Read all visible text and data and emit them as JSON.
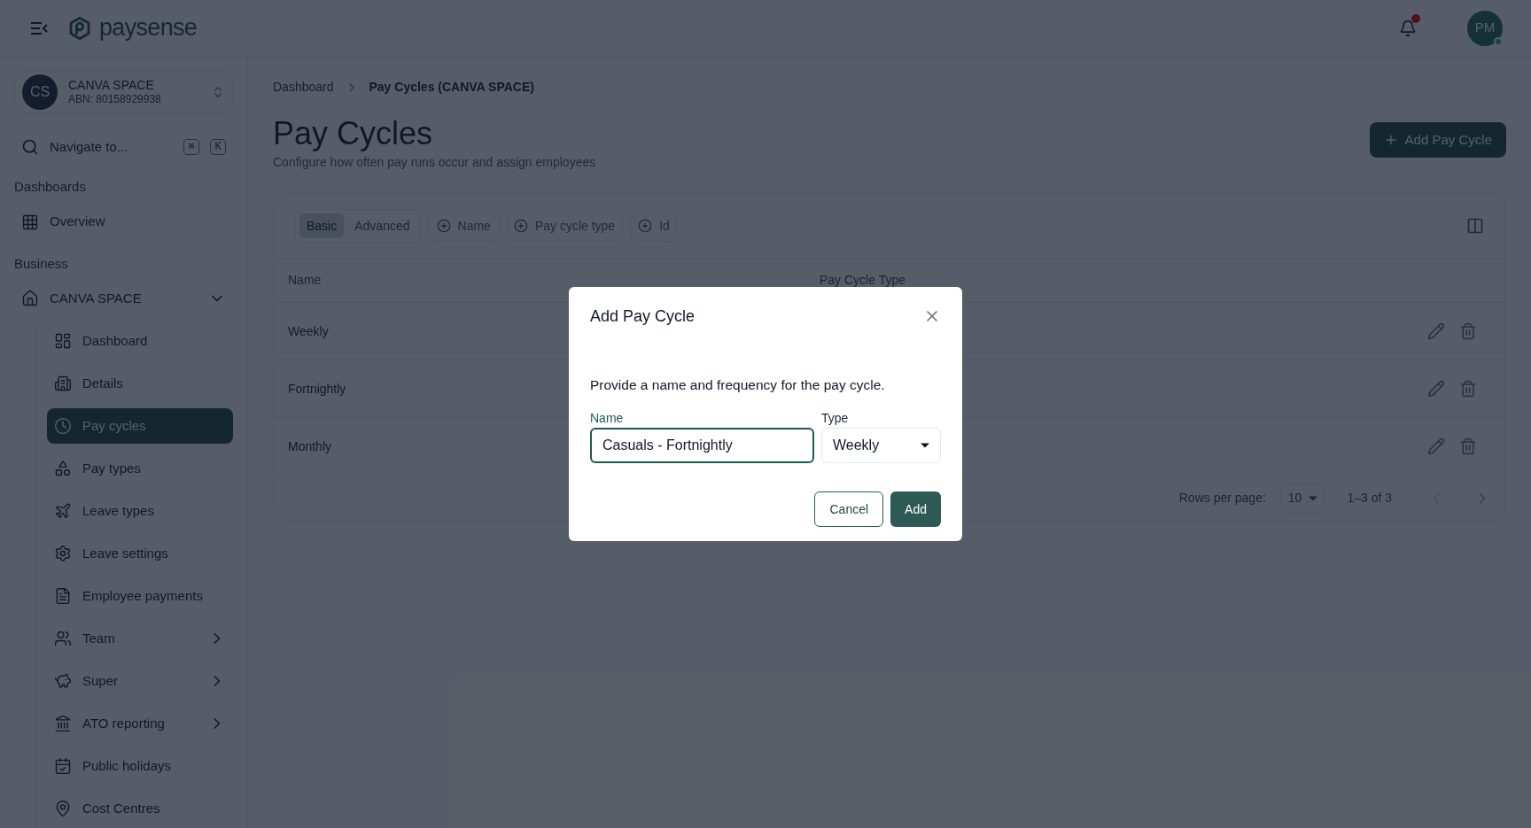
{
  "header": {
    "brand": "paysense",
    "notification": true,
    "avatar": {
      "initials": "PM",
      "online": true
    }
  },
  "sidebar": {
    "workspace": {
      "initials": "CS",
      "name": "CANVA SPACE",
      "abn": "ABN: 80158929938"
    },
    "search": {
      "placeholder": "Navigate to...",
      "keys": [
        "⌘",
        "K"
      ]
    },
    "sections": [
      {
        "title": "Dashboards",
        "items": [
          {
            "label": "Overview",
            "selected": false
          }
        ]
      },
      {
        "title": "Business",
        "items": [
          {
            "label": "CANVA SPACE",
            "selected": false,
            "expanded": true,
            "children": [
              {
                "label": "Dashboard",
                "selected": false
              },
              {
                "label": "Details",
                "selected": false
              },
              {
                "label": "Pay cycles",
                "selected": true
              },
              {
                "label": "Pay types",
                "selected": false
              },
              {
                "label": "Leave types",
                "selected": false
              },
              {
                "label": "Leave settings",
                "selected": false
              },
              {
                "label": "Employee payments",
                "selected": false
              },
              {
                "label": "Team",
                "selected": false,
                "expanded": false
              },
              {
                "label": "Super",
                "selected": false,
                "expanded": false
              },
              {
                "label": "ATO reporting",
                "selected": false,
                "expanded": false
              },
              {
                "label": "Public holidays",
                "selected": false
              },
              {
                "label": "Cost Centres",
                "selected": false
              }
            ]
          }
        ]
      }
    ]
  },
  "breadcrumb": [
    {
      "label": "Dashboard",
      "selected": false
    },
    {
      "label": "Pay Cycles (CANVA SPACE)",
      "selected": true
    }
  ],
  "page": {
    "title": "Pay Cycles",
    "subtitle": "Configure how often pay runs occur and assign employees",
    "action": "Add Pay Cycle"
  },
  "filters": {
    "modes": [
      {
        "label": "Basic",
        "selected": true
      },
      {
        "label": "Advanced",
        "selected": false
      }
    ],
    "chips": [
      "Name",
      "Pay cycle type",
      "Id"
    ]
  },
  "table": {
    "columns": [
      "Name",
      "Pay Cycle Type"
    ],
    "rows": [
      {
        "name": "Weekly"
      },
      {
        "name": "Fortnightly"
      },
      {
        "name": "Monthly"
      }
    ],
    "footer": {
      "rows_label": "Rows per page:",
      "rows_value": "10",
      "range": "1–3 of 3"
    }
  },
  "dialog": {
    "title": "Add Pay Cycle",
    "text": "Provide a name and frequency for the pay cycle.",
    "fields": [
      {
        "kind": "text",
        "label": "Name",
        "value": "Casuals - Fortnightly",
        "focused": true
      },
      {
        "kind": "select",
        "label": "Type",
        "value": "Weekly",
        "focused": false
      }
    ],
    "buttons": [
      {
        "kind": "secondary",
        "label": "Cancel"
      },
      {
        "kind": "primary",
        "label": "Add"
      }
    ]
  }
}
